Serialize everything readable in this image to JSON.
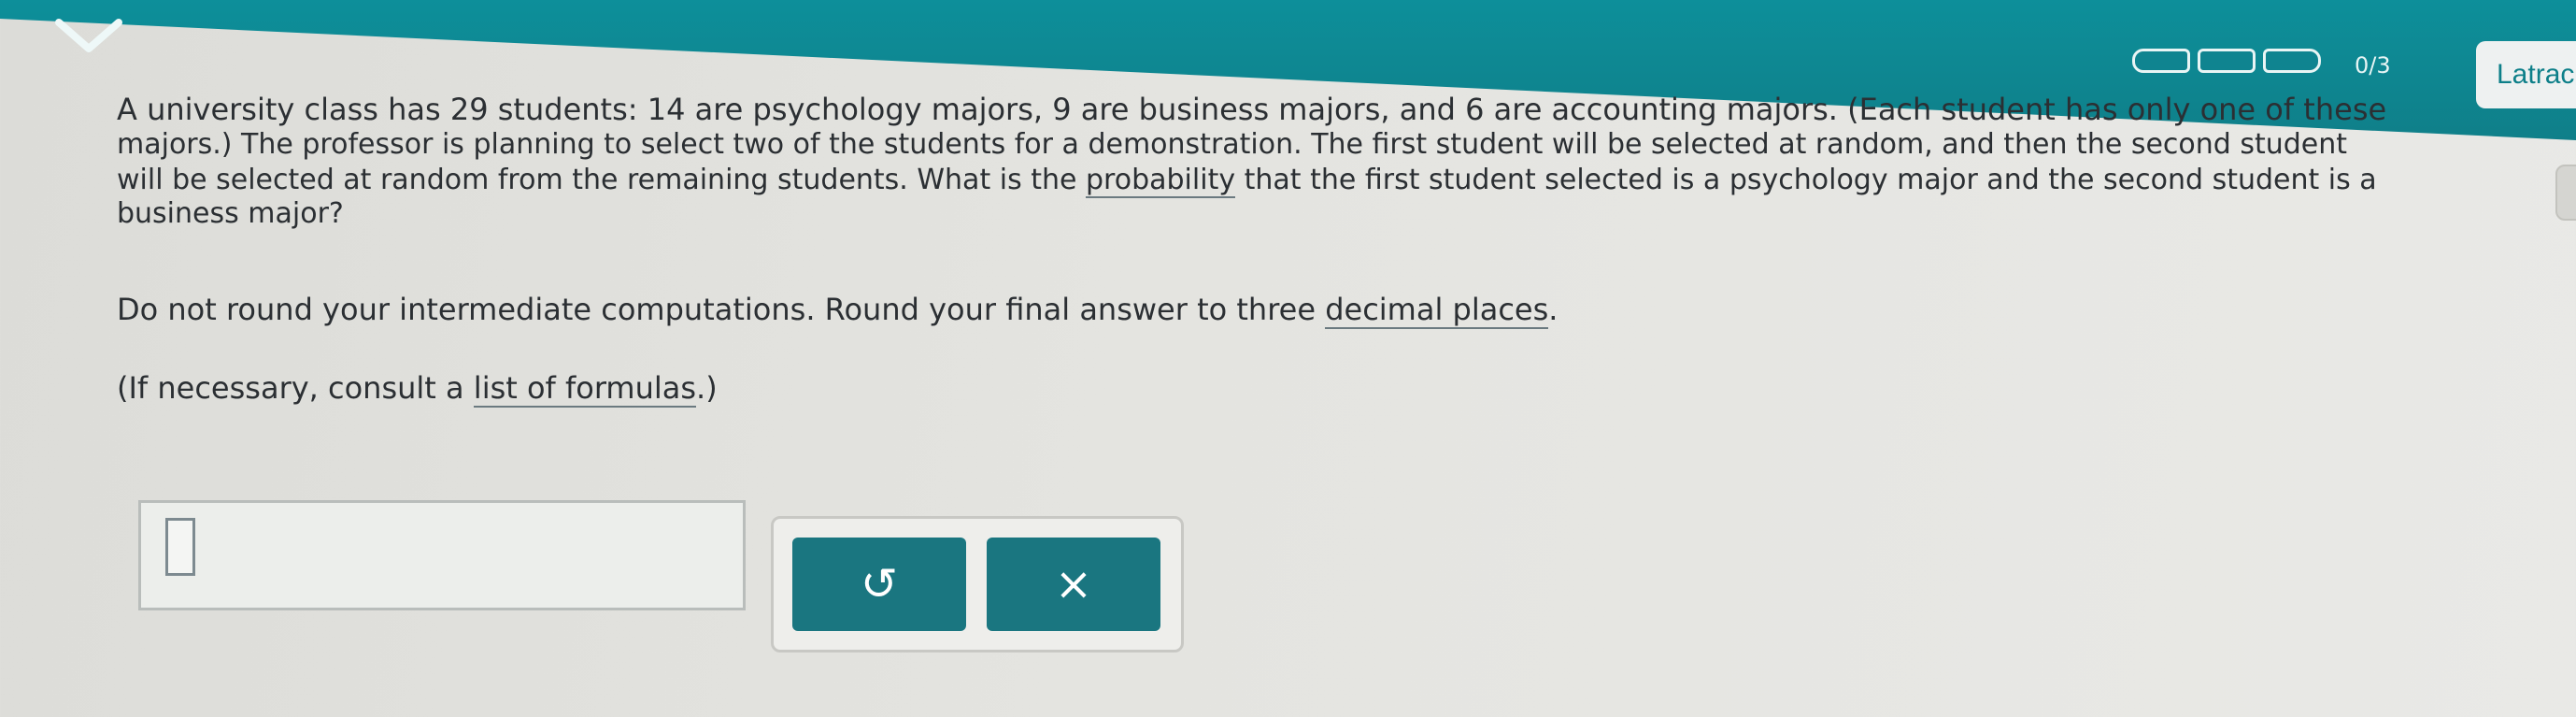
{
  "header": {
    "progress_text": "0/3",
    "progress_segments": 3,
    "language_button": "Latrac"
  },
  "question": {
    "line1": "A university class has 29 students: 14 are psychology majors, 9 are business majors, and 6 are accounting majors. (Each student has only one of these",
    "line2": "majors.) The professor is planning to select two of the students for a demonstration. The first student will be selected at random, and then the second student",
    "line3_a": "will be selected at random from the remaining students. What is the ",
    "line3_link": "probability",
    "line3_b": " that the first student selected is a psychology major and the second student is a",
    "line4": "business major?",
    "instruction_a": "Do not round your intermediate computations. Round your final answer to three ",
    "instruction_link": "decimal places",
    "instruction_b": ".",
    "formulas_a": "(If necessary, consult a ",
    "formulas_link": "list of formulas",
    "formulas_b": ".)"
  },
  "answer": {
    "value": ""
  },
  "tools": {
    "undo_label": "↺",
    "clear_label": "×"
  },
  "icons": {
    "menu": "chevron-down-icon",
    "undo": "undo-icon",
    "clear": "close-icon"
  }
}
